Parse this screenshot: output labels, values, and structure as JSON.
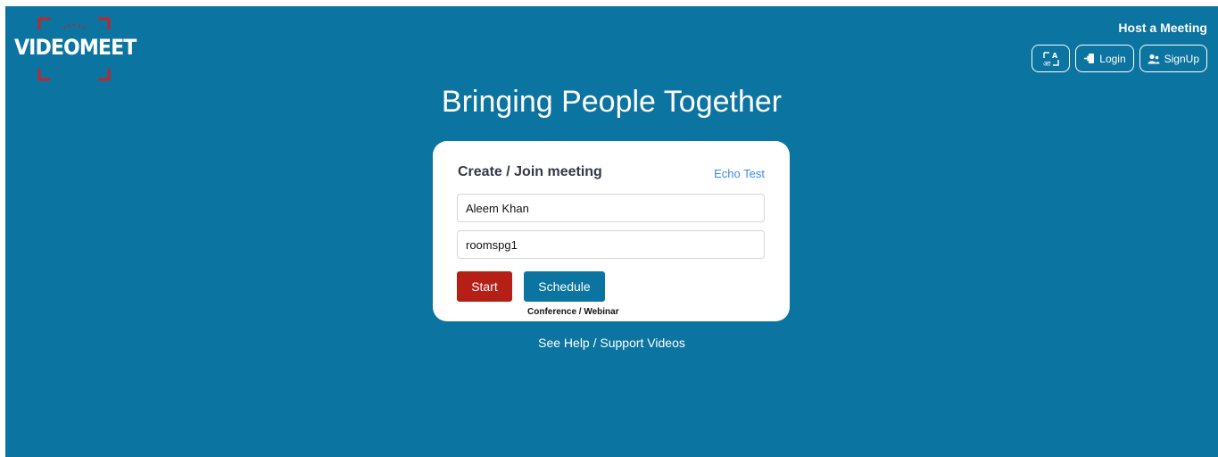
{
  "brand": {
    "logo_text": "VIDEOMEET",
    "accent_color": "#c0262c",
    "background_color": "#0c74a0"
  },
  "header": {
    "host_link": "Host a Meeting",
    "buttons": {
      "language_icon": "translate-icon",
      "login_label": "Login",
      "login_icon": "sign-in-icon",
      "signup_label": "SignUp",
      "signup_icon": "users-icon"
    }
  },
  "hero": {
    "headline": "Bringing People Together"
  },
  "meeting_card": {
    "title": "Create / Join meeting",
    "echo_test_link": "Echo Test",
    "name_value": "Aleem Khan",
    "room_value": "roomspg1",
    "start_label": "Start",
    "schedule_label": "Schedule",
    "schedule_sublabel": "Conference / Webinar",
    "start_color": "#b51f16"
  },
  "footer": {
    "help_link": "See Help / Support Videos"
  }
}
